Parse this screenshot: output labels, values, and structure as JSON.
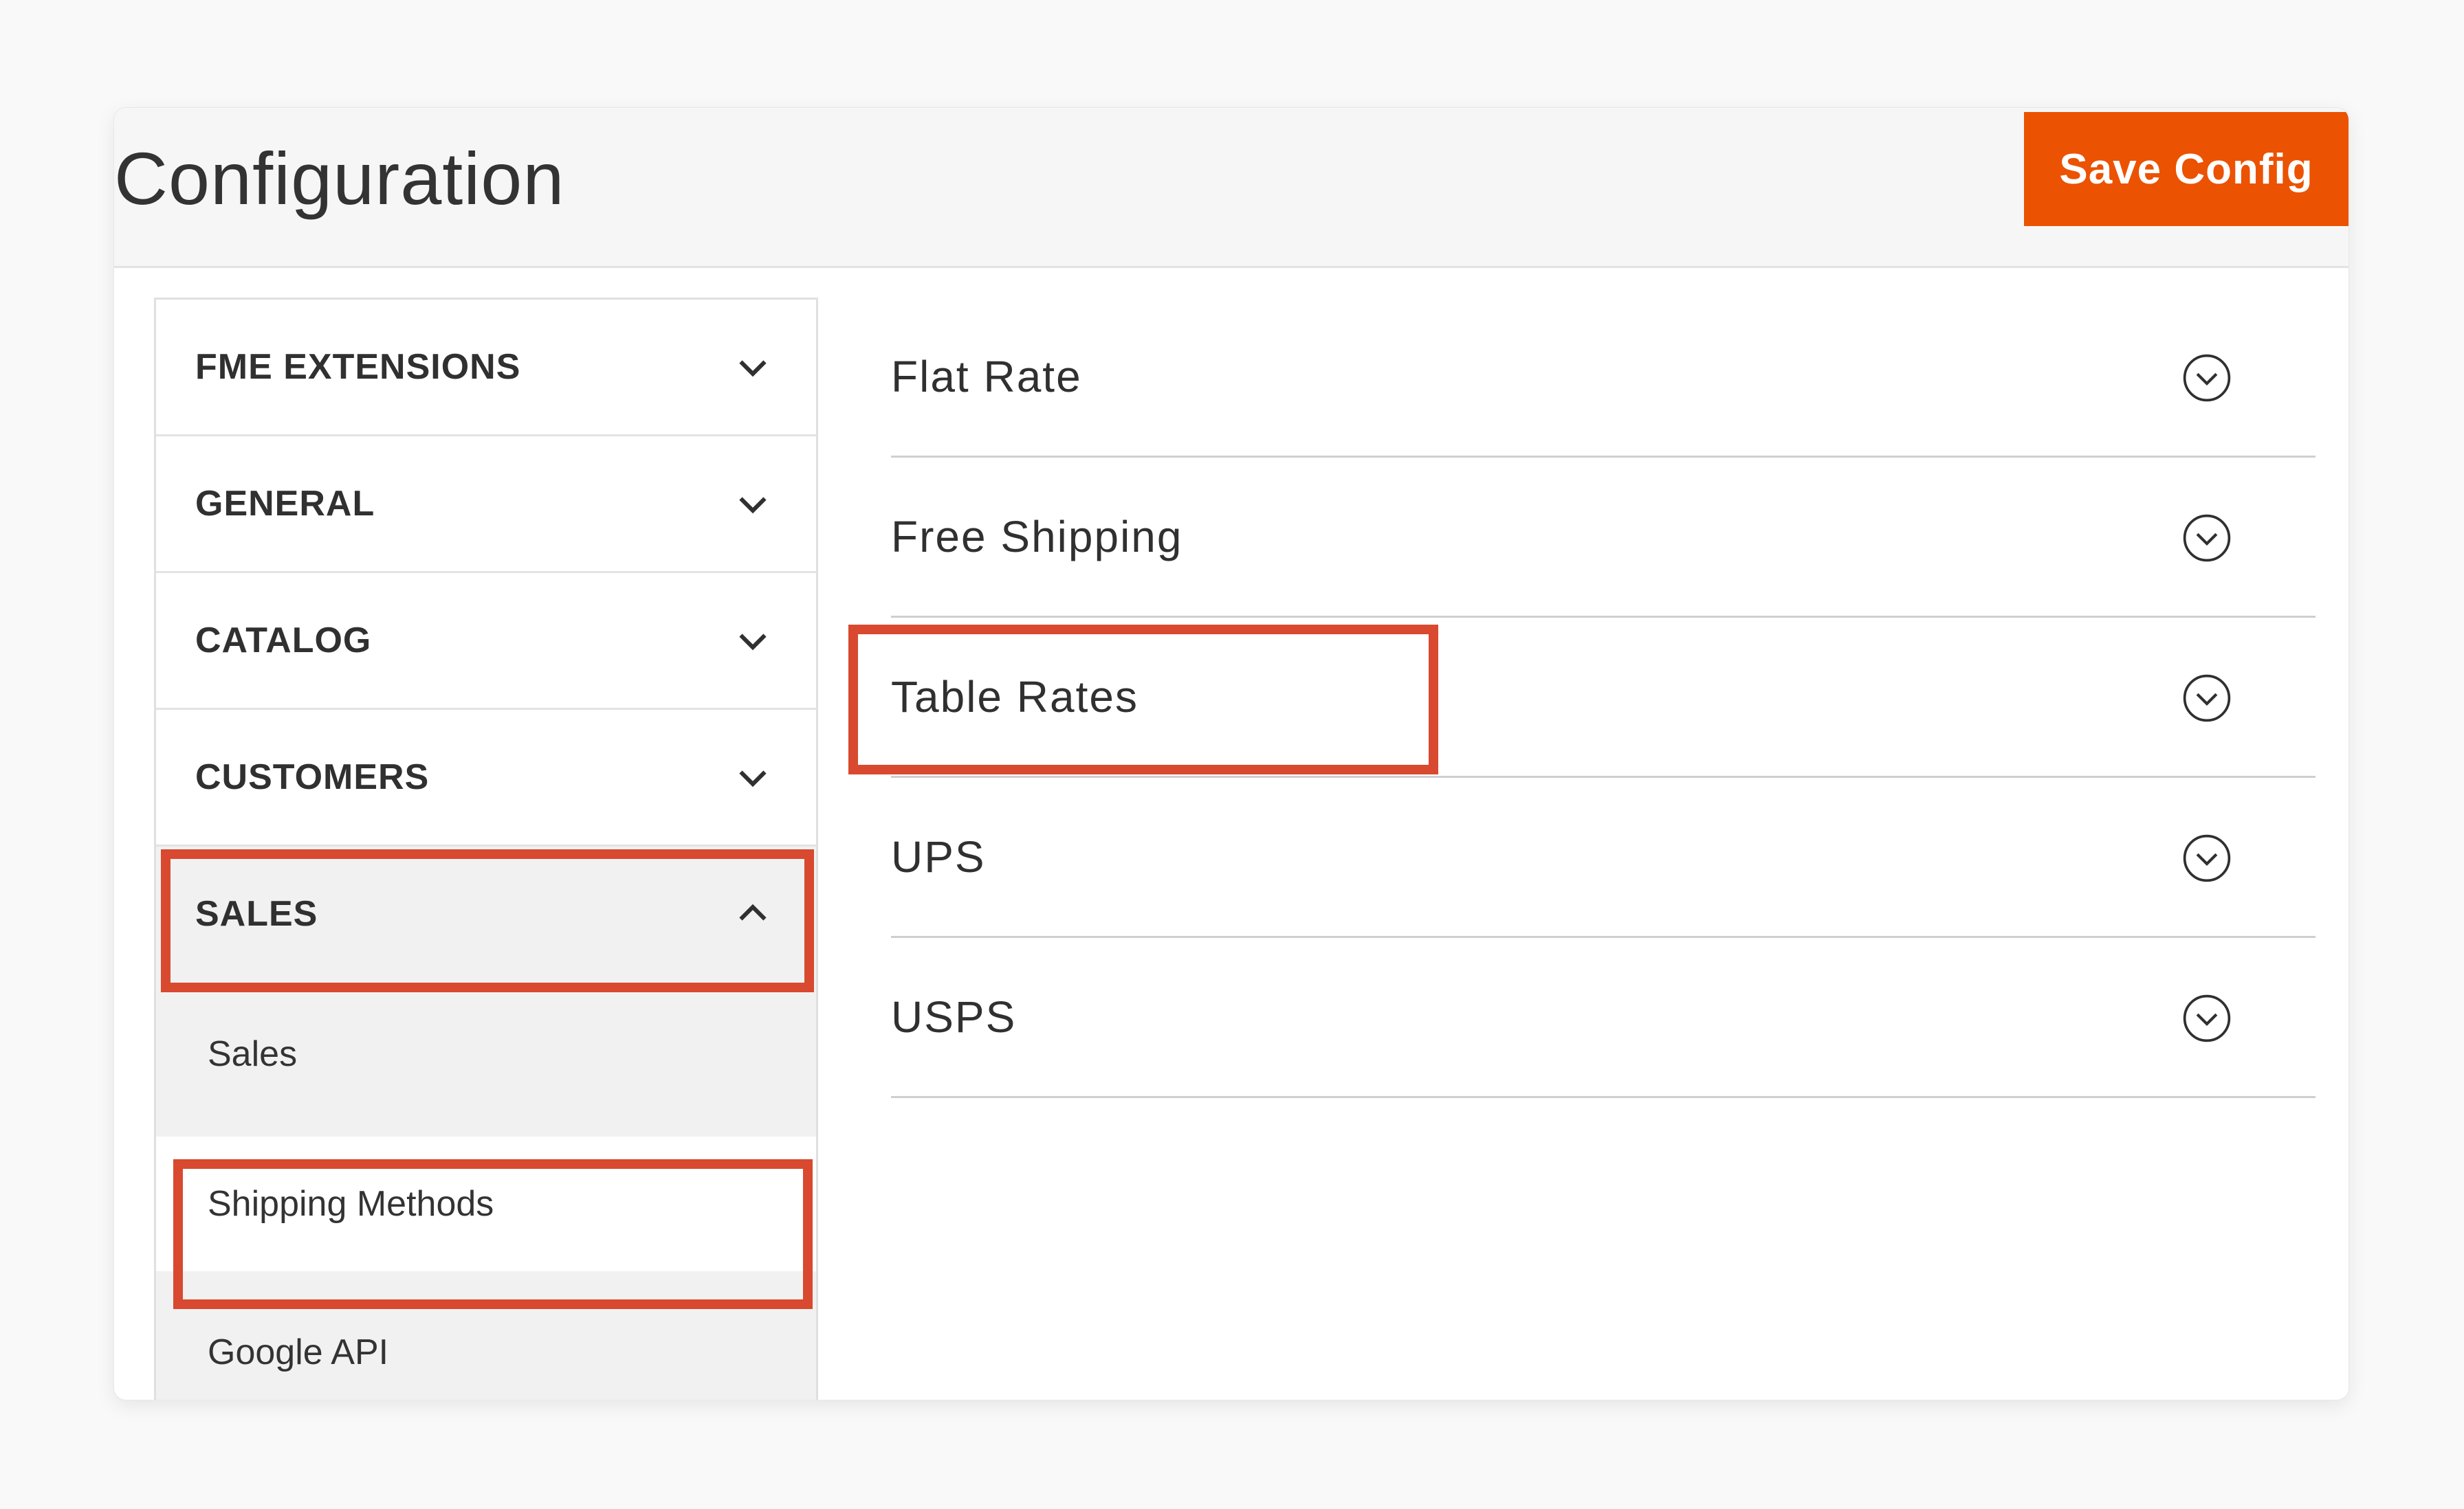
{
  "header": {
    "title": "Configuration",
    "save_label": "Save Config"
  },
  "sidebar": {
    "items": [
      {
        "label": "FME EXTENSIONS",
        "icon": "chevron-down-icon"
      },
      {
        "label": "GENERAL",
        "icon": "chevron-down-icon"
      },
      {
        "label": "CATALOG",
        "icon": "chevron-down-icon"
      },
      {
        "label": "CUSTOMERS",
        "icon": "chevron-down-icon"
      },
      {
        "label": "SALES",
        "icon": "chevron-up-icon",
        "expanded": true
      }
    ],
    "subitems": [
      {
        "label": "Sales"
      },
      {
        "label": "Shipping Methods",
        "selected": true
      },
      {
        "label": "Google API"
      }
    ]
  },
  "main": {
    "sections": [
      {
        "title": "Flat Rate",
        "icon": "circle-chevron-down-icon"
      },
      {
        "title": "Free Shipping",
        "icon": "circle-chevron-down-icon"
      },
      {
        "title": "Table Rates",
        "icon": "circle-chevron-down-icon"
      },
      {
        "title": "UPS",
        "icon": "circle-chevron-down-icon"
      },
      {
        "title": "USPS",
        "icon": "circle-chevron-down-icon"
      }
    ]
  },
  "colors": {
    "accent": "#eb5202",
    "highlight": "#d8492f",
    "page_bg": "#f9f9f9",
    "sidebar_bg": "#f1f1f1"
  }
}
